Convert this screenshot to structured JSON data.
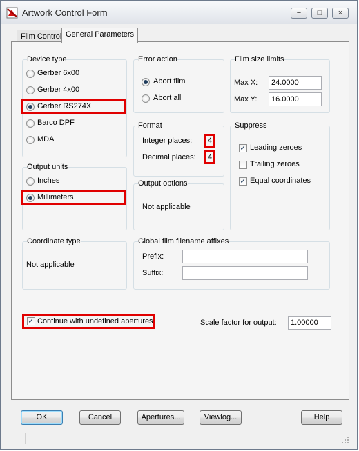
{
  "window": {
    "title": "Artwork Control Form"
  },
  "tabs": [
    {
      "label": "Film Control",
      "active": false
    },
    {
      "label": "General Parameters",
      "active": true
    }
  ],
  "device_type": {
    "label": "Device type",
    "options": [
      "Gerber 6x00",
      "Gerber 4x00",
      "Gerber RS274X",
      "Barco DPF",
      "MDA"
    ],
    "selected": "Gerber RS274X"
  },
  "error_action": {
    "label": "Error action",
    "options": [
      "Abort film",
      "Abort all"
    ],
    "selected": "Abort film"
  },
  "film_size_limits": {
    "label": "Film size limits",
    "max_x_label": "Max X:",
    "max_x_value": "24.0000",
    "max_y_label": "Max Y:",
    "max_y_value": "16.0000"
  },
  "format": {
    "label": "Format",
    "integer_label": "Integer places:",
    "integer_value": "4",
    "decimal_label": "Decimal places:",
    "decimal_value": "4"
  },
  "suppress": {
    "label": "Suppress",
    "items": [
      {
        "label": "Leading zeroes",
        "checked": true
      },
      {
        "label": "Trailing zeroes",
        "checked": false
      },
      {
        "label": "Equal coordinates",
        "checked": true
      }
    ]
  },
  "output_units": {
    "label": "Output units",
    "options": [
      "Inches",
      "Millimeters"
    ],
    "selected": "Millimeters"
  },
  "output_options": {
    "label": "Output options",
    "text": "Not applicable"
  },
  "coordinate_type": {
    "label": "Coordinate type",
    "text": "Not applicable"
  },
  "affixes": {
    "label": "Global film filename affixes",
    "prefix_label": "Prefix:",
    "prefix_value": "",
    "suffix_label": "Suffix:",
    "suffix_value": ""
  },
  "continue_undefined": {
    "label": "Continue with undefined apertures",
    "checked": true
  },
  "scale": {
    "label": "Scale factor for output:",
    "value": "1.00000"
  },
  "buttons": {
    "ok": "OK",
    "cancel": "Cancel",
    "apertures": "Apertures...",
    "viewlog": "Viewlog...",
    "help": "Help"
  },
  "title_buttons": {
    "minimize": "−",
    "maximize": "□",
    "close": "×"
  },
  "colors": {
    "highlight": "#e00000",
    "accent": "#1f3c5c"
  }
}
